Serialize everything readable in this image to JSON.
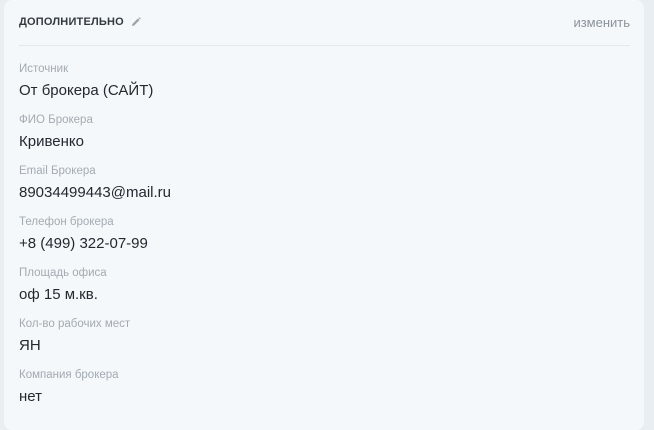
{
  "section": {
    "title": "дополнительно",
    "edit_link": "изменить"
  },
  "fields": [
    {
      "label": "Источник",
      "value": "От брокера (САЙТ)"
    },
    {
      "label": "ФИО Брокера",
      "value": "Кривенко"
    },
    {
      "label": "Email Брокера",
      "value": "89034499443@mail.ru"
    },
    {
      "label": "Телефон брокера",
      "value": "+8 (499) 322-07-99"
    },
    {
      "label": "Площадь офиса",
      "value": "оф 15 м.кв."
    },
    {
      "label": "Кол-во рабочих мест",
      "value": "ЯН"
    },
    {
      "label": "Компания брокера",
      "value": "нет"
    }
  ]
}
